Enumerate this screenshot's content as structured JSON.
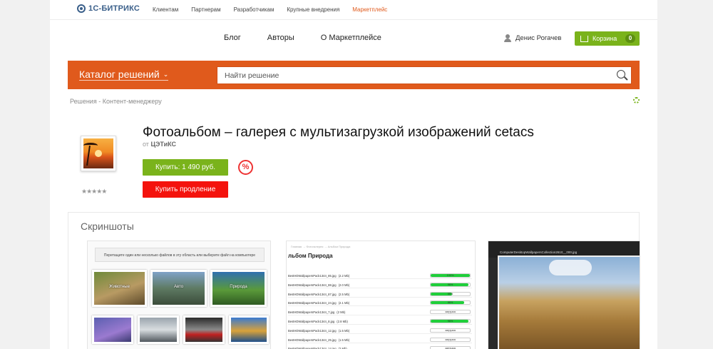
{
  "topbar": {
    "logo": "1С-БИТРИКС",
    "links": [
      "Клиентам",
      "Партнерам",
      "Разработчикам",
      "Крупные внедрения",
      "Маркетплейс"
    ]
  },
  "mainnav": {
    "links": [
      "Блог",
      "Авторы",
      "О Маркетплейсе"
    ]
  },
  "user": {
    "name": "Денис Рогачев"
  },
  "cart": {
    "label": "Корзина",
    "count": "0"
  },
  "catalog": {
    "label": "Каталог решений"
  },
  "search": {
    "placeholder": "Найти решение"
  },
  "breadcrumb": {
    "items": [
      "Решения",
      "Контент-менеджеру"
    ],
    "separator": "-"
  },
  "product": {
    "title": "Фотоальбом – галерея с мультизагрузкой изображений cetacs",
    "vendor_prefix": "от",
    "vendor": "ЦЭТиКС",
    "buy_label": "Купить: 1 490 руб.",
    "discount_symbol": "%",
    "renew_label": "Купить продление",
    "rating_stars": "★★★★★",
    "rating": 0
  },
  "screenshots": {
    "heading": "Скриншоты",
    "shot1": {
      "dropzone": "Перетащите один или несколько файлов в эту область или выберите файл на компьютере",
      "captions": [
        "Животные",
        "Авто",
        "Природа"
      ]
    },
    "shot2": {
      "crumb": "Главная → Фотогалерея → Альбом Природа",
      "title": "льбом Природа",
      "rows": [
        {
          "file": "BestHDWallpapersPack1344_85.jpg",
          "size": "(2.2 Mb)",
          "progress": 1.0,
          "status": "100%"
        },
        {
          "file": "BestHDWallpapersPack1344_88.jpg",
          "size": "(2.0 Mb)",
          "progress": 0.96,
          "status": "96%"
        },
        {
          "file": "BestHDWallpapersPack1344_87.jpg",
          "size": "(2.5 Mb)",
          "progress": 0.55,
          "status": "55%"
        },
        {
          "file": "BestHDWallpapersPack1344_24.jpg",
          "size": "(2.1 Mb)",
          "progress": 0.86,
          "status": "86%"
        },
        {
          "file": "BestHDWallpapersPack1344_7.jpg",
          "size": "(2 Mb)",
          "progress": 0,
          "status": "загрузка"
        },
        {
          "file": "BestHDWallpapersPack1344_8.jpg",
          "size": "(2.8 Mb)",
          "progress": 0.96,
          "status": "96%"
        },
        {
          "file": "BestHDWallpapersPack1344_12.jpg",
          "size": "(1.5 Mb)",
          "progress": 0,
          "status": "загрузка"
        },
        {
          "file": "BestHDWallpapersPack1344_25.jpg",
          "size": "(1.5 Mb)",
          "progress": 0,
          "status": "загрузка"
        },
        {
          "file": "BestHDWallpapersPack1344_14.jpg",
          "size": "(2 Mb)",
          "progress": 0,
          "status": "загрузка"
        }
      ]
    },
    "shot3": {
      "caption": "ComputerDesktopWallpapersCollection2610__000.jpg"
    }
  },
  "colors": {
    "accent": "#e05a1c",
    "green": "#7ab31b",
    "red": "#f4130d"
  }
}
